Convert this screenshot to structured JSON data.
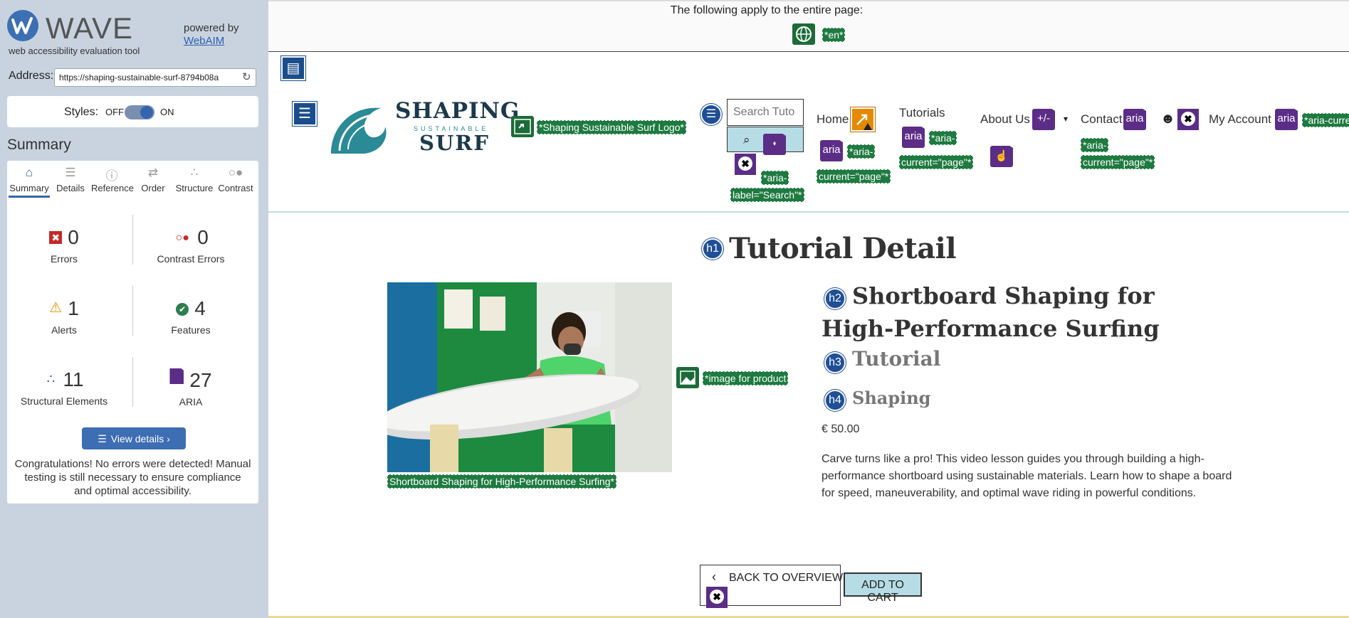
{
  "wave": {
    "title": "WAVE",
    "subtitle": "web accessibility evaluation tool",
    "powered_by": "powered by",
    "webaim": "WebAIM",
    "address_label": "Address:",
    "address_value": "https://shaping-sustainable-surf-8794b08a",
    "styles_label": "Styles:",
    "styles_off": "OFF",
    "styles_on": "ON",
    "summary_heading": "Summary",
    "tabs": [
      {
        "label": "Summary",
        "icon": "home-icon"
      },
      {
        "label": "Details",
        "icon": "list-icon"
      },
      {
        "label": "Reference",
        "icon": "info-icon"
      },
      {
        "label": "Order",
        "icon": "order-icon"
      },
      {
        "label": "Structure",
        "icon": "structure-icon"
      },
      {
        "label": "Contrast",
        "icon": "contrast-icon"
      }
    ],
    "stats": {
      "errors": {
        "value": "0",
        "label": "Errors",
        "color": "#c62828"
      },
      "contrast_errors": {
        "value": "0",
        "label": "Contrast Errors",
        "color": "#c62828"
      },
      "alerts": {
        "value": "1",
        "label": "Alerts",
        "color": "#e69500"
      },
      "features": {
        "value": "4",
        "label": "Features",
        "color": "#2e7d4f"
      },
      "structural": {
        "value": "11",
        "label": "Structural Elements",
        "color": "#1a4d8c"
      },
      "aria": {
        "value": "27",
        "label": "ARIA",
        "color": "#5b2d86"
      }
    },
    "view_details": "View details ›",
    "congrats": "Congratulations! No errors were detected! Manual testing is still necessary to ensure compliance and optimal accessibility."
  },
  "page": {
    "apply_text": "The following apply to the entire page:",
    "lang_label": "*en*",
    "logo": {
      "line1": "SHAPING",
      "line2": "SUSTAINABLE",
      "line3": "SURF",
      "label": "*Shaping Sustainable Surf Logo*"
    },
    "search": {
      "placeholder": "Search Tuto",
      "aria_label_1": "*aria-",
      "aria_label_2": "label=\"Search\"*"
    },
    "nav": {
      "home": "Home",
      "tutorials": "Tutorials",
      "about": "About Us",
      "contact": "Contact",
      "account": "My Account",
      "aria_current_a": "*aria-",
      "aria_current_b": "current=\"page\"*",
      "aria_current_edge": "*aria-curre",
      "aria_text": "aria",
      "plusminus": "+/-"
    },
    "h1": "Tutorial Detail",
    "h2": "Shortboard Shaping for High-Performance Surfing",
    "h3": "Tutorial",
    "h4": "Shaping",
    "price": "€ 50.00",
    "description": "Carve turns like a pro! This video lesson guides you through building a high-performance shortboard using sustainable materials. Learn how to shape a board for speed, maneuverability, and optimal wave riding in powerful conditions.",
    "image_alt_label": "*image for product",
    "image_caption": "Shortboard Shaping for High-Performance Surfing*",
    "back_button": "BACK TO OVERVIEW",
    "cart_button": "ADD TO CART",
    "h_levels": {
      "h1": "h1",
      "h2": "h2",
      "h3": "h3",
      "h4": "h4"
    }
  }
}
